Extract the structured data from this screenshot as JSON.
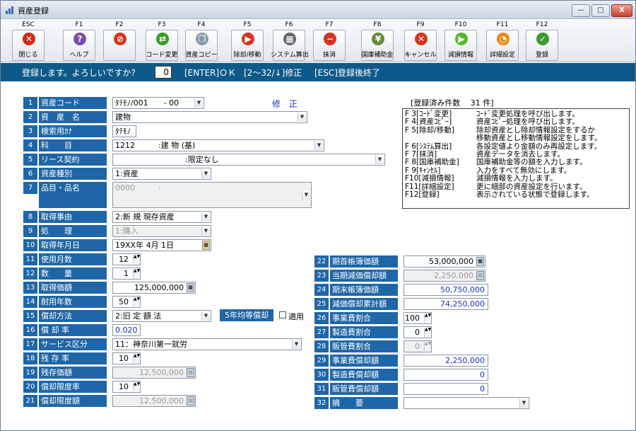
{
  "window": {
    "title": "資産登録",
    "min": "—",
    "max": "□",
    "close": "X"
  },
  "toolbar": [
    {
      "key": "ESC",
      "label": "閉じる",
      "icon": "exit-icon",
      "color": "#d02a1a",
      "glyph": "✕"
    },
    {
      "key": "F1",
      "label": "ヘルプ",
      "icon": "help-icon",
      "color": "#7b4ea8",
      "glyph": "?"
    },
    {
      "key": "F2",
      "label": "",
      "icon": "prohibit-icon",
      "color": "#d8331f",
      "glyph": "⊘"
    },
    {
      "key": "F3",
      "label": "コード変更",
      "icon": "shuffle-icon",
      "color": "#3a9a2a",
      "glyph": "⇄"
    },
    {
      "key": "F4",
      "label": "資産コピー",
      "icon": "copy-icon",
      "color": "#8899aa",
      "glyph": "❐"
    },
    {
      "key": "F5",
      "label": "除却/移動",
      "icon": "play-red-icon",
      "color": "#d8331f",
      "glyph": "▶"
    },
    {
      "key": "F6",
      "label": "システム算出",
      "icon": "calculator-icon",
      "color": "#666666",
      "glyph": "▦"
    },
    {
      "key": "F7",
      "label": "抹消",
      "icon": "erase-doc-icon",
      "color": "#d8331f",
      "glyph": "−"
    },
    {
      "key": "F8",
      "label": "国庫補助金",
      "icon": "money-icon",
      "color": "#6a8a3a",
      "glyph": "¥"
    },
    {
      "key": "F9",
      "label": "キャンセル",
      "icon": "cancel-icon",
      "color": "#d8331f",
      "glyph": "✕"
    },
    {
      "key": "F10",
      "label": "減損情報",
      "icon": "play-green-icon",
      "color": "#5cb82e",
      "glyph": "▶"
    },
    {
      "key": "F11",
      "label": "詳細設定",
      "icon": "pie-icon",
      "color": "#e88a1a",
      "glyph": "◔"
    },
    {
      "key": "F12",
      "label": "登録",
      "icon": "check-icon",
      "color": "#3a9a2a",
      "glyph": "✓"
    }
  ],
  "status": {
    "prompt": "登録します。よろしいですか?",
    "value": "0",
    "enter": "[ENTER]ＯＫ",
    "fix": "[2～32/↓]修正",
    "esc": "[ESC]登録後終了"
  },
  "mode": "修　正",
  "count": "[登録済み件数　 31 件]",
  "info": [
    {
      "k": "F 3[ｺｰﾄﾞ変更]",
      "v": "ｺｰﾄﾞ変更処理を呼び出します。"
    },
    {
      "k": "F 4[資産ｺﾋﾟｰ]",
      "v": "資産ｺﾋﾟｰ処理を呼び出します。"
    },
    {
      "k": "F 5[除却/移動]",
      "v": "除却資産とし除却情報設定をするか"
    },
    {
      "k": "",
      "v": "移動資産とし移動情報設定をします。"
    },
    {
      "k": "F 6[ｼｽﾃﾑ算出]",
      "v": "各設定値より金額のみ再設定します。"
    },
    {
      "k": "F 7[抹消]",
      "v": "資産データを消去します。"
    },
    {
      "k": "F 8[国庫補助金]",
      "v": "国庫補助金等の額を入力します。"
    },
    {
      "k": "F 9[ｷｬﾝｾﾙ]",
      "v": "入力をすべて無効にします。"
    },
    {
      "k": "F10[減損情報]",
      "v": "減損情報を入力します。"
    },
    {
      "k": "F11[詳細設定]",
      "v": "更に細部の資産設定を行います。"
    },
    {
      "k": "F12[登録]",
      "v": "表示されている状態で登録します。"
    }
  ],
  "left": [
    {
      "n": "1",
      "label": "資産コード",
      "value": "ﾀﾃﾓﾉ/001　　- 00"
    },
    {
      "n": "2",
      "label": "資　産　名",
      "value": "建物"
    },
    {
      "n": "3",
      "label": "検索用ｶﾅ",
      "value": "ﾀﾃﾓﾉ"
    },
    {
      "n": "4",
      "label": "科　　目",
      "value": "1212　　　:建 物 (基)"
    },
    {
      "n": "5",
      "label": "リース契約",
      "value": "　　　　　　　　　:限定なし"
    },
    {
      "n": "6",
      "label": "資産種別",
      "value": "1:資産"
    },
    {
      "n": "7",
      "label": "品目・品名",
      "value": "0000　　　:"
    },
    {
      "n": "8",
      "label": "取得事由",
      "value": "2:新 規 現存資産"
    },
    {
      "n": "9",
      "label": "処　　理",
      "value": "1:購入"
    },
    {
      "n": "10",
      "label": "取得年月日",
      "value": "19XX年 4月 1日"
    },
    {
      "n": "11",
      "label": "使用月数",
      "value": "12"
    },
    {
      "n": "12",
      "label": "数　　量",
      "value": "1"
    },
    {
      "n": "13",
      "label": "取得価額",
      "value": "125,000,000"
    },
    {
      "n": "14",
      "label": "耐用年数",
      "value": "50"
    },
    {
      "n": "15",
      "label": "償却方法",
      "value": "2:旧 定 額 法"
    },
    {
      "n": "16",
      "label": "償 却 率",
      "value": "0.020"
    },
    {
      "n": "17",
      "label": "サービス区分",
      "value": "11：神奈川第一就労"
    },
    {
      "n": "18",
      "label": "残 存 率",
      "value": "10"
    },
    {
      "n": "19",
      "label": "残存価額",
      "value": "12,500,000"
    },
    {
      "n": "20",
      "label": "償却限度率",
      "value": "10"
    },
    {
      "n": "21",
      "label": "償却限度額",
      "value": "12,500,000"
    }
  ],
  "five_year": {
    "label": "5年均等償却",
    "check": "適用"
  },
  "right": [
    {
      "n": "22",
      "label": "期首帳簿価額",
      "value": "53,000,000"
    },
    {
      "n": "23",
      "label": "当期減価償却額",
      "value": "2,250,000"
    },
    {
      "n": "24",
      "label": "期末帳簿価額",
      "value": "50,750,000"
    },
    {
      "n": "25",
      "label": "減価償却累計額",
      "value": "74,250,000"
    },
    {
      "n": "26",
      "label": "事業費割合",
      "value": "100"
    },
    {
      "n": "27",
      "label": "製造費割合",
      "value": "0"
    },
    {
      "n": "28",
      "label": "販管費割合",
      "value": "0"
    },
    {
      "n": "29",
      "label": "事業費償却額",
      "value": "2,250,000"
    },
    {
      "n": "30",
      "label": "製造費償却額",
      "value": "0"
    },
    {
      "n": "31",
      "label": "販管費償却額",
      "value": "0"
    },
    {
      "n": "32",
      "label": "摘　　要",
      "value": ""
    }
  ]
}
